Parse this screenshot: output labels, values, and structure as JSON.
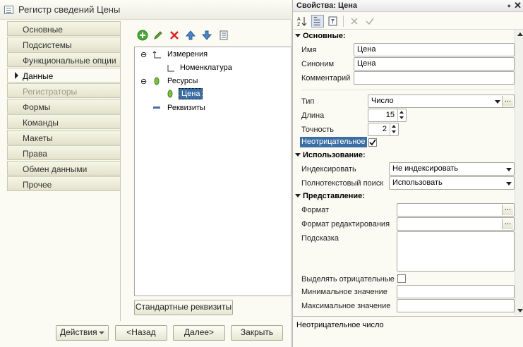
{
  "left_window": {
    "title": "Регистр сведений Цены",
    "tabs": [
      {
        "label": "Основные",
        "state": "normal"
      },
      {
        "label": "Подсистемы",
        "state": "normal"
      },
      {
        "label": "Функциональные опции",
        "state": "normal"
      },
      {
        "label": "Данные",
        "state": "active"
      },
      {
        "label": "Регистраторы",
        "state": "disabled"
      },
      {
        "label": "Формы",
        "state": "normal"
      },
      {
        "label": "Команды",
        "state": "normal"
      },
      {
        "label": "Макеты",
        "state": "normal"
      },
      {
        "label": "Права",
        "state": "normal"
      },
      {
        "label": "Обмен данными",
        "state": "normal"
      },
      {
        "label": "Прочее",
        "state": "normal"
      }
    ],
    "toolbar_icons": [
      "add-icon",
      "edit-icon",
      "delete-icon",
      "move-up-icon",
      "move-down-icon",
      "list-icon"
    ],
    "tree": {
      "dimensions": "Измерения",
      "dimension_item": "Номенклатура",
      "resources": "Ресурсы",
      "resource_item": "Цена",
      "attributes": "Реквизиты"
    },
    "standard_attributes_button": "Стандартные реквизиты",
    "footer_buttons": {
      "actions": "Действия",
      "back": "<Назад",
      "next": "Далее>",
      "close": "Закрыть"
    }
  },
  "properties": {
    "title": "Свойства: Цена",
    "sections": {
      "main": "Основные:",
      "usage": "Использование:",
      "presentation": "Представление:"
    },
    "fields": {
      "name_label": "Имя",
      "name_value": "Цена",
      "synonym_label": "Синоним",
      "synonym_value": "Цена",
      "comment_label": "Комментарий",
      "comment_value": "",
      "type_label": "Тип",
      "type_value": "Число",
      "length_label": "Длина",
      "length_value": "15",
      "precision_label": "Точность",
      "precision_value": "2",
      "nonnegative_label": "Неотрицательное",
      "nonnegative_checked": true,
      "index_label": "Индексировать",
      "index_value": "Не индексировать",
      "fulltext_label": "Полнотекстовый поиск",
      "fulltext_value": "Использовать",
      "format_label": "Формат",
      "edit_format_label": "Формат редактирования",
      "tooltip_label": "Подсказка",
      "mark_negative_label": "Выделять отрицательные",
      "min_value_label": "Минимальное значение",
      "max_value_label": "Максимальное значение"
    },
    "description": "Неотрицательное число"
  },
  "colors": {
    "highlight": "#3a6ea5",
    "window_bg": "#fbfbf3"
  }
}
